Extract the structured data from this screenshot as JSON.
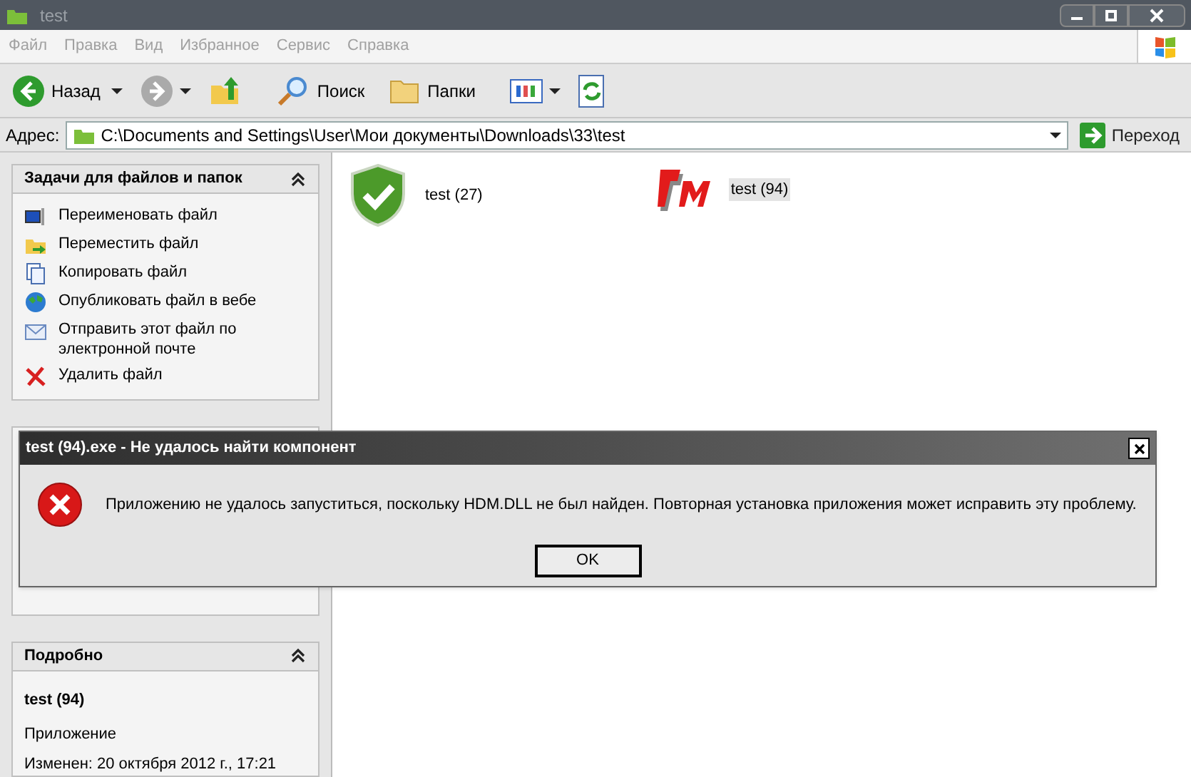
{
  "window": {
    "title": "test"
  },
  "menu": [
    "Файл",
    "Правка",
    "Вид",
    "Избранное",
    "Сервис",
    "Справка"
  ],
  "toolbar": {
    "back": "Назад",
    "search": "Поиск",
    "folders": "Папки"
  },
  "address": {
    "label": "Адрес:",
    "value": "C:\\Documents and Settings\\User\\Мои документы\\Downloads\\33\\test",
    "go": "Переход"
  },
  "tasks": {
    "title": "Задачи для файлов и папок",
    "items": [
      {
        "kind": "rename",
        "label": "Переименовать файл"
      },
      {
        "kind": "move",
        "label": "Переместить файл"
      },
      {
        "kind": "copy",
        "label": "Копировать файл"
      },
      {
        "kind": "publish",
        "label": "Опубликовать файл в вебе"
      },
      {
        "kind": "mail",
        "label": "Отправить этот файл по электронной почте"
      },
      {
        "kind": "delete",
        "label": "Удалить файл"
      }
    ]
  },
  "details": {
    "title": "Подробно",
    "name": "test (94)",
    "type": "Приложение",
    "modified": "Изменен: 20 октября 2012 г., 17:21"
  },
  "files": [
    {
      "kind": "shield",
      "name": "test (27)",
      "selected": false
    },
    {
      "kind": "app",
      "name": "test (94)",
      "selected": true
    }
  ],
  "dialog": {
    "title": "test (94).exe - Не удалось найти компонент",
    "message": "Приложению не удалось запуститься, поскольку HDM.DLL не был найден. Повторная установка приложения может исправить эту проблему.",
    "ok": "OK"
  }
}
